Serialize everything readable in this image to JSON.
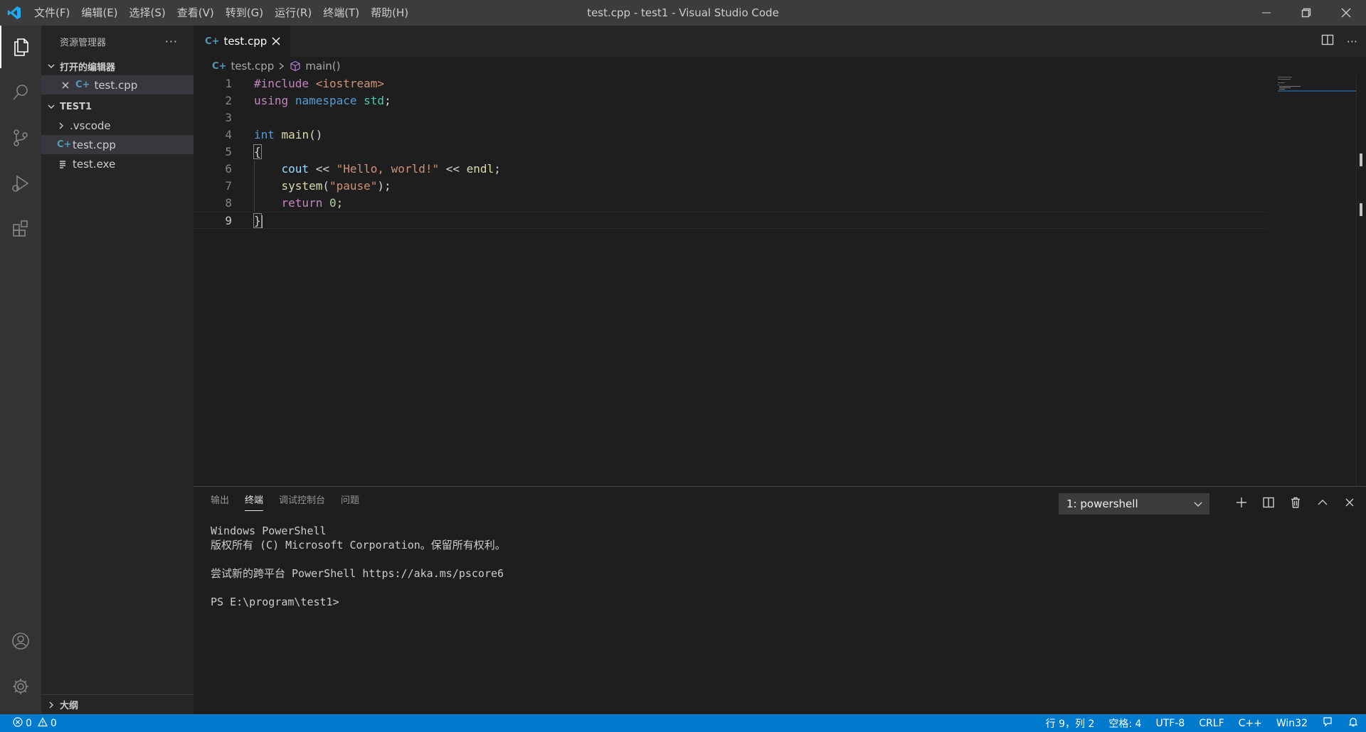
{
  "titlebar": {
    "title": "test.cpp - test1 - Visual Studio Code",
    "menu": [
      "文件(F)",
      "编辑(E)",
      "选择(S)",
      "查看(V)",
      "转到(G)",
      "运行(R)",
      "终端(T)",
      "帮助(H)"
    ]
  },
  "sidebar": {
    "title": "资源管理器",
    "open_editors_label": "打开的编辑器",
    "open_editors": [
      {
        "name": "test.cpp"
      }
    ],
    "folder_label": "TEST1",
    "files": [
      {
        "name": ".vscode",
        "type": "folder"
      },
      {
        "name": "test.cpp",
        "type": "cpp"
      },
      {
        "name": "test.exe",
        "type": "file"
      }
    ],
    "outline_label": "大纲"
  },
  "editor": {
    "tab_label": "test.cpp",
    "breadcrumb": {
      "file": "test.cpp",
      "symbol": "main()"
    },
    "lines": [
      {
        "n": "1",
        "text": "#include <iostream>"
      },
      {
        "n": "2",
        "text": "using namespace std;"
      },
      {
        "n": "3",
        "text": ""
      },
      {
        "n": "4",
        "text": "int main()"
      },
      {
        "n": "5",
        "text": "{"
      },
      {
        "n": "6",
        "text": "    cout << \"Hello, world!\" << endl;"
      },
      {
        "n": "7",
        "text": "    system(\"pause\");"
      },
      {
        "n": "8",
        "text": "    return 0;"
      },
      {
        "n": "9",
        "text": "}"
      }
    ]
  },
  "panel": {
    "tabs": [
      "输出",
      "终端",
      "调试控制台",
      "问题"
    ],
    "active_tab": "终端",
    "terminal_select": "1: powershell",
    "terminal_lines": [
      "Windows PowerShell",
      "版权所有 (C) Microsoft Corporation。保留所有权利。",
      "",
      "尝试新的跨平台 PowerShell https://aka.ms/pscore6",
      "",
      "PS E:\\program\\test1>"
    ]
  },
  "statusbar": {
    "errors": "0",
    "warnings": "0",
    "position": "行 9，列 2",
    "spaces": "空格: 4",
    "encoding": "UTF-8",
    "eol": "CRLF",
    "language": "C++",
    "platform": "Win32"
  },
  "colors": {
    "accent": "#007acc",
    "titlebar": "#3c3c3c",
    "activitybar": "#333333",
    "sidebar": "#252526",
    "editor": "#1e1e1e",
    "cpp_icon": "#519aba"
  }
}
